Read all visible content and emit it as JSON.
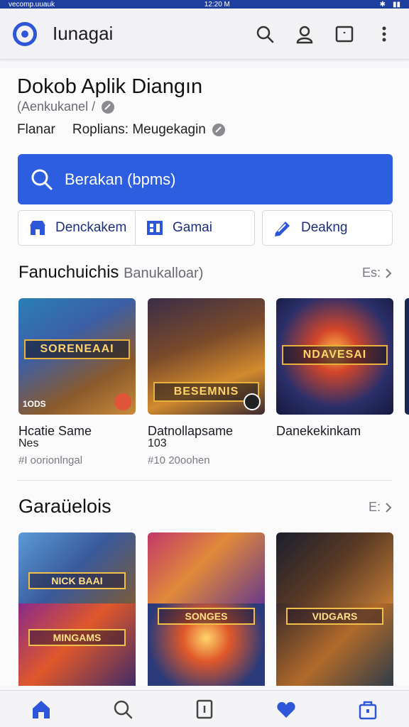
{
  "status": {
    "left": "vecomp.uuauk",
    "time": "12:20 M"
  },
  "appbar": {
    "title": "Iunagai",
    "icons": [
      "search-icon",
      "account-icon",
      "messages-icon",
      "more-icon"
    ]
  },
  "store": {
    "title": "Dokob Aplik Diangın",
    "subtitle": "(Aenkukanel /",
    "meta_left": "Flanar",
    "meta_right": "Roplians: Meugekagin"
  },
  "search": {
    "placeholder": "Berakan (bpms)"
  },
  "chips": [
    {
      "label": "Denckakem",
      "icon": "store-icon"
    },
    {
      "label": "Gamai",
      "icon": "grid-icon"
    },
    {
      "label": "Deakng",
      "icon": "edit-icon"
    }
  ],
  "section1": {
    "title": "Fanuchuichis",
    "title_muted": "Banukalloar)",
    "see_more": "Es:",
    "cards": [
      {
        "banner": "SORENEAAI",
        "corner": "1ODS",
        "name": "Hcatie Same",
        "sub": "Nes",
        "meta": "#I oorionlngal"
      },
      {
        "banner": "BESEMNIS",
        "corner": "",
        "name": "Datnollapsame",
        "sub": "103",
        "meta": "#10 20oohen"
      },
      {
        "banner": "NDAVESAI",
        "corner": "",
        "name": "Danekekinkam",
        "sub": "",
        "meta": ""
      }
    ]
  },
  "section2": {
    "title": "Garaüelois",
    "see_more": "E:",
    "tiles": [
      {
        "banner": "NICK BAAI"
      },
      {
        "banner": ""
      },
      {
        "banner": ""
      },
      {
        "banner": "MINGAMS"
      },
      {
        "banner": "SONGES"
      },
      {
        "banner": "VIDGARS"
      }
    ]
  },
  "bottomnav": [
    "home-icon",
    "search-icon",
    "tabs-icon",
    "favorites-icon",
    "bag-icon"
  ],
  "colors": {
    "accent": "#2e5ee0",
    "appbar": "#f2f2f4",
    "chip_text": "#1e2f78"
  }
}
